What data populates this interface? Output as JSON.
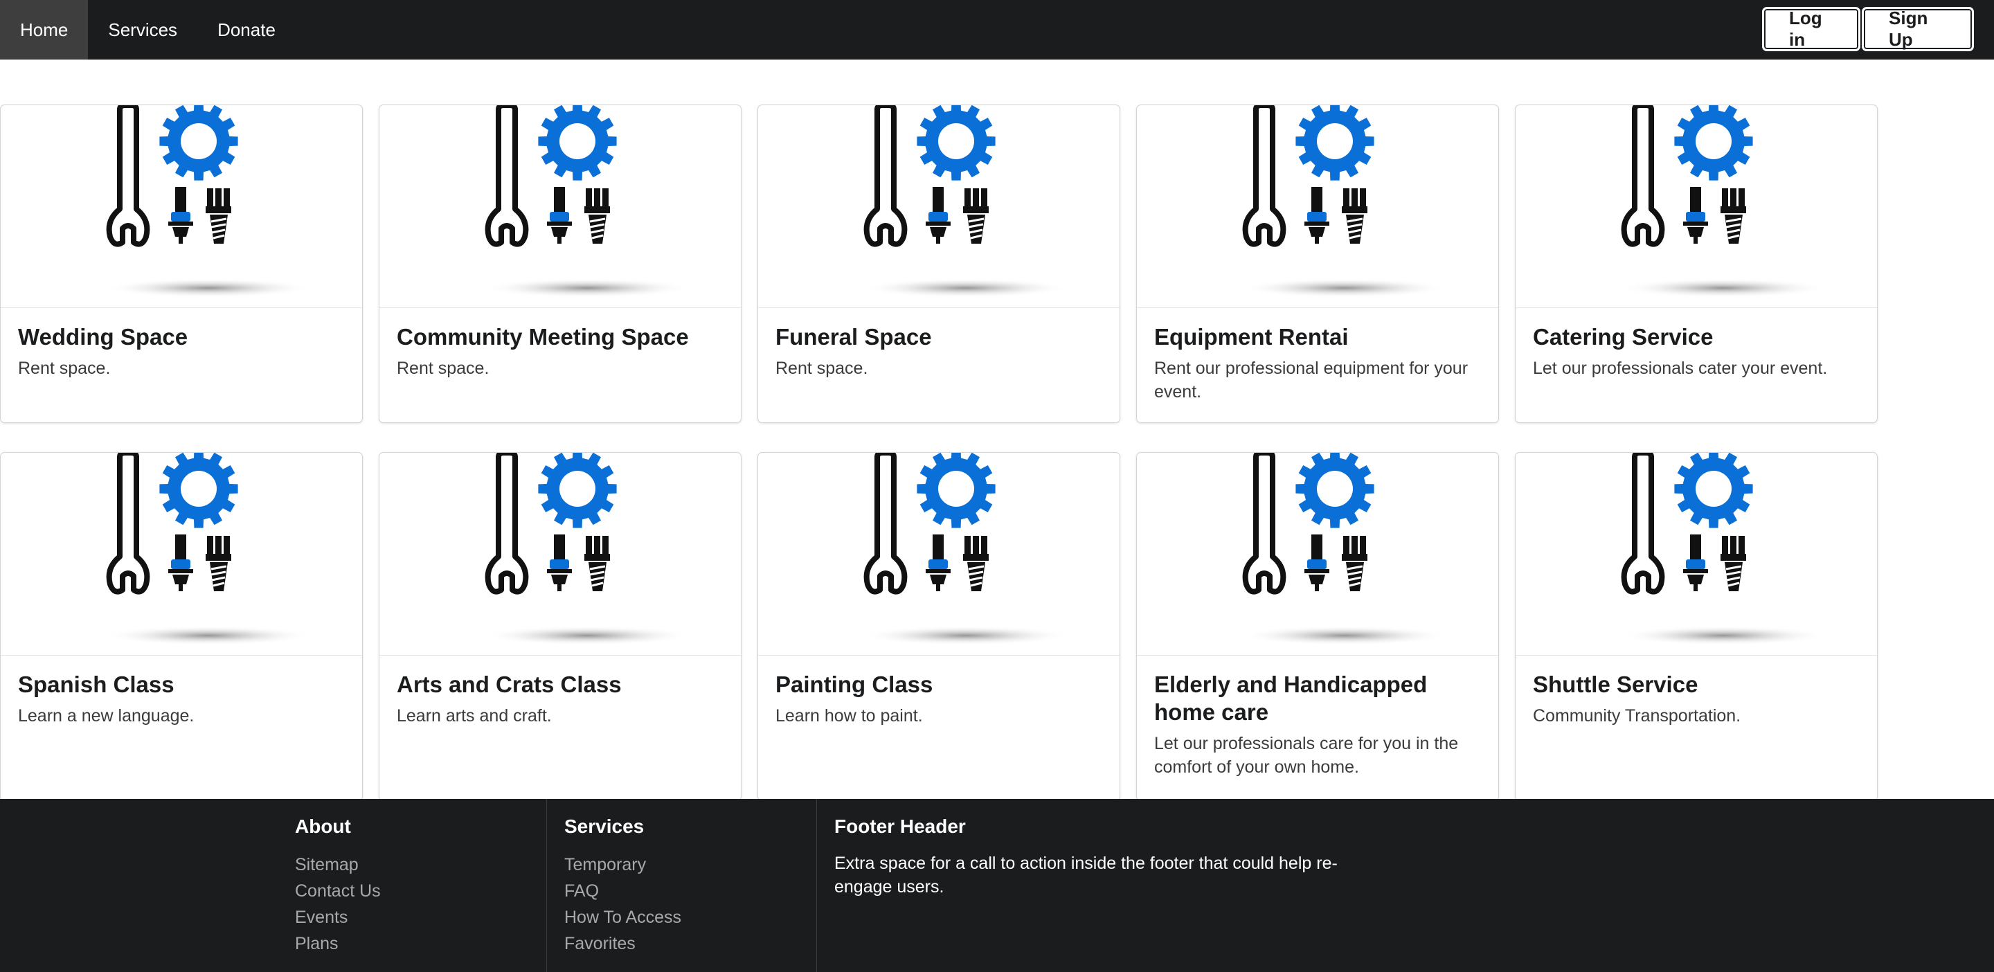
{
  "nav": {
    "items": [
      {
        "label": "Home"
      },
      {
        "label": "Services"
      },
      {
        "label": "Donate"
      }
    ],
    "login_label": "Log in",
    "signup_label": "Sign Up"
  },
  "colors": {
    "topbar": "#1b1c1d",
    "active_nav": "#3e3e3f",
    "icon_blue": "#0a6fd6",
    "footer": "#1b1c1d"
  },
  "cards": [
    {
      "title": "Wedding Space",
      "description": "Rent space.",
      "icon": "tools-gear-icon"
    },
    {
      "title": "Community Meeting Space",
      "description": "Rent space.",
      "icon": "tools-gear-icon"
    },
    {
      "title": "Funeral Space",
      "description": "Rent space.",
      "icon": "tools-gear-icon"
    },
    {
      "title": "Equipment Rentai",
      "description": "Rent our professional equipment for your event.",
      "icon": "tools-gear-icon"
    },
    {
      "title": "Catering Service",
      "description": "Let our professionals cater your event.",
      "icon": "tools-gear-icon"
    },
    {
      "title": "Spanish Class",
      "description": "Learn a new language.",
      "icon": "tools-gear-icon"
    },
    {
      "title": "Arts and Crats Class",
      "description": "Learn arts and craft.",
      "icon": "tools-gear-icon"
    },
    {
      "title": "Painting Class",
      "description": "Learn how to paint.",
      "icon": "tools-gear-icon"
    },
    {
      "title": "Elderly and Handicapped home care",
      "description": "Let our professionals care for you in the comfort of your own home.",
      "icon": "tools-gear-icon"
    },
    {
      "title": "Shuttle Service",
      "description": "Community Transportation.",
      "icon": "tools-gear-icon"
    }
  ],
  "footer": {
    "about": {
      "heading": "About",
      "links": [
        "Sitemap",
        "Contact Us",
        "Events",
        "Plans"
      ]
    },
    "services": {
      "heading": "Services",
      "links": [
        "Temporary",
        "FAQ",
        "How To Access",
        "Favorites"
      ]
    },
    "cta": {
      "heading": "Footer Header",
      "text": "Extra space for a call to action inside the footer that could help re-engage users."
    }
  }
}
